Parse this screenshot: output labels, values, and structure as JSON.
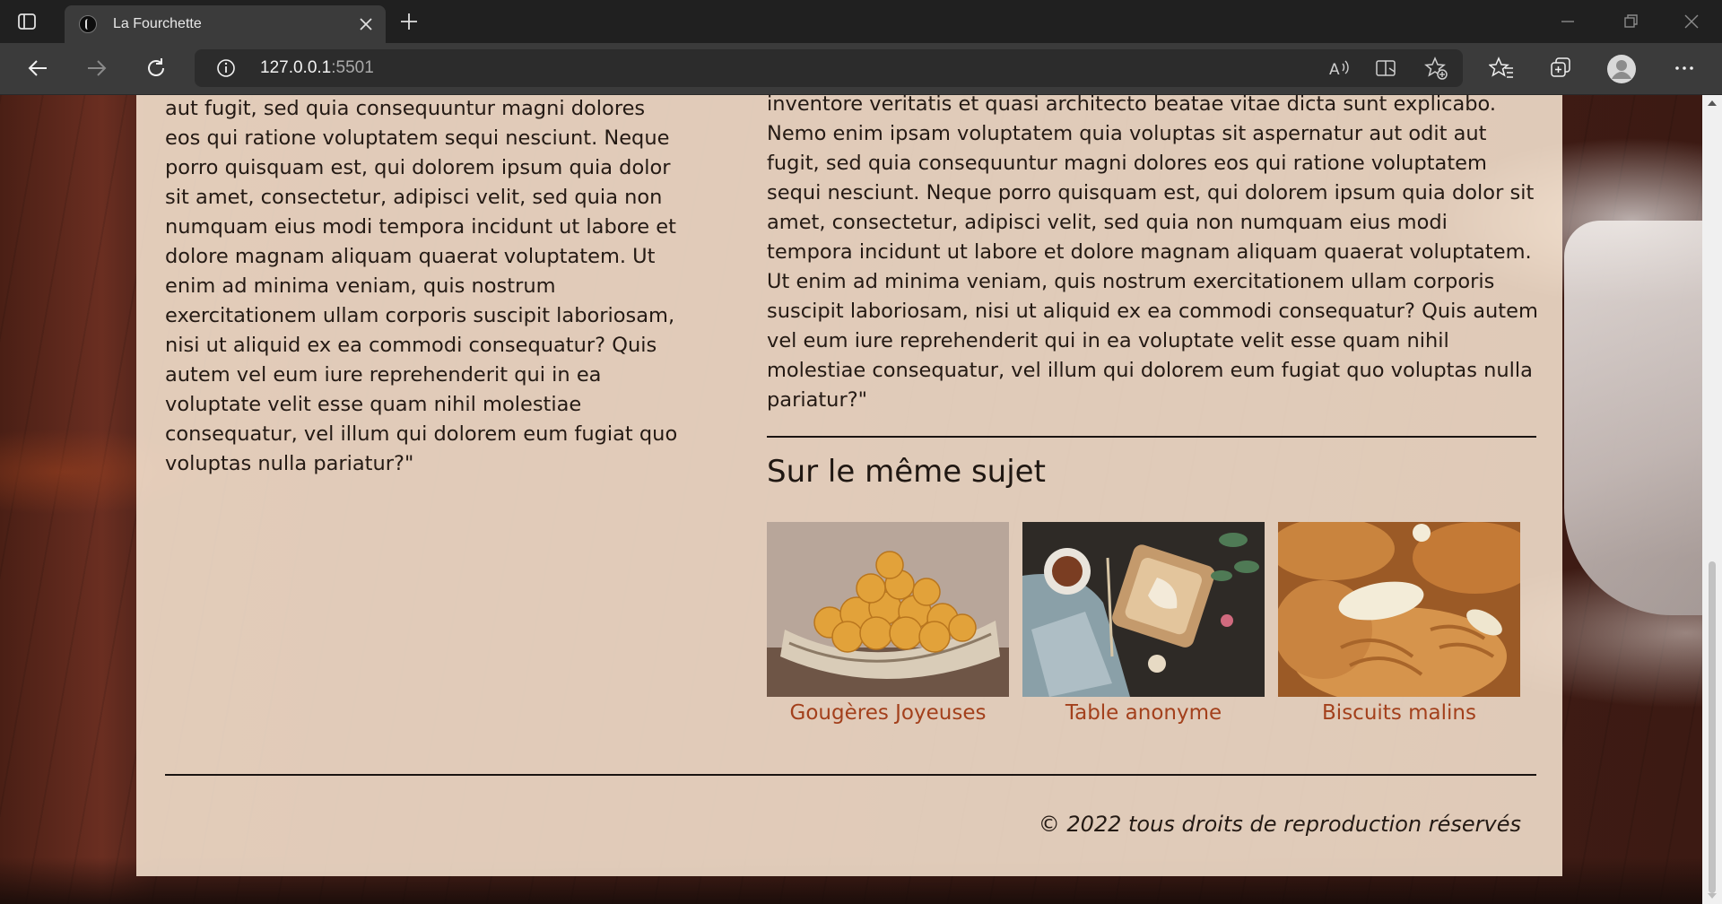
{
  "browser": {
    "tab_title": "La Fourchette",
    "address_host": "127.0.0.1",
    "address_port": ":5501"
  },
  "article": {
    "left_text": "aut fugit, sed quia consequuntur magni dolores eos qui ratione voluptatem sequi nesciunt. Neque porro quisquam est, qui dolorem ipsum quia dolor sit amet, consectetur, adipisci velit, sed quia non numquam eius modi tempora incidunt ut labore et dolore magnam aliquam quaerat voluptatem. Ut enim ad minima veniam, quis nostrum exercitationem ullam corporis suscipit laboriosam, nisi ut aliquid ex ea commodi consequatur? Quis autem vel eum iure reprehenderit qui in ea voluptate velit esse quam nihil molestiae consequatur, vel illum qui dolorem eum fugiat quo voluptas nulla pariatur?\"",
    "right_text": "inventore veritatis et quasi architecto beatae vitae dicta sunt explicabo. Nemo enim ipsam voluptatem quia voluptas sit aspernatur aut odit aut fugit, sed quia consequuntur magni dolores eos qui ratione voluptatem sequi nesciunt. Neque porro quisquam est, qui dolorem ipsum quia dolor sit amet, consectetur, adipisci velit, sed quia non numquam eius modi tempora incidunt ut labore et dolore magnam aliquam quaerat voluptatem. Ut enim ad minima veniam, quis nostrum exercitationem ullam corporis suscipit laboriosam, nisi ut aliquid ex ea commodi consequatur? Quis autem vel eum iure reprehenderit qui in ea voluptate velit esse quam nihil molestiae consequatur, vel illum qui dolorem eum fugiat quo voluptas nulla pariatur?\""
  },
  "related": {
    "title": "Sur le même sujet",
    "items": [
      {
        "title": "Gougères Joyeuses",
        "image": "gougeres-photo"
      },
      {
        "title": "Table anonyme",
        "image": "table-photo"
      },
      {
        "title": "Biscuits malins",
        "image": "biscuits-photo"
      }
    ]
  },
  "footer": {
    "copyright": "© 2022 tous droits de reproduction réservés"
  },
  "colors": {
    "link": "#a3401c",
    "panel": "#fae8d4"
  }
}
